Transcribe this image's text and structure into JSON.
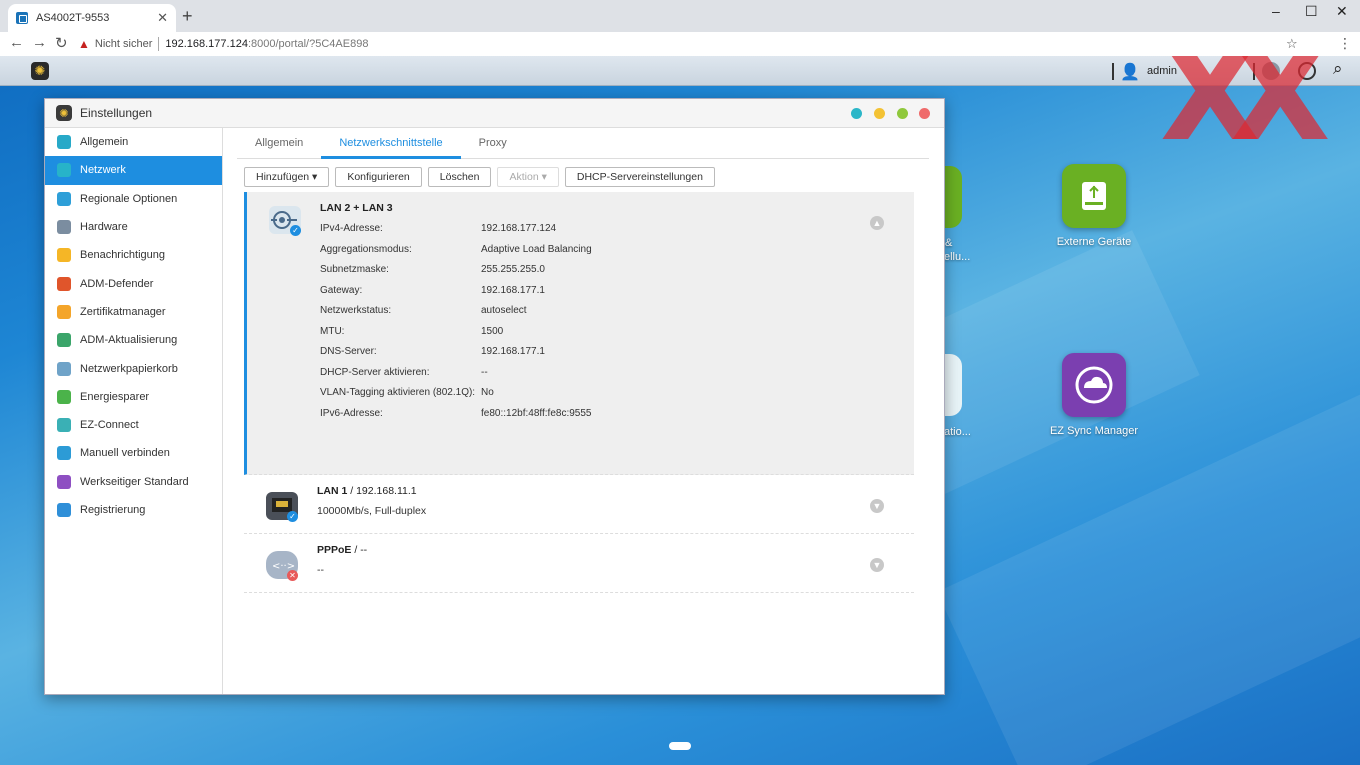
{
  "browser": {
    "tab_title": "AS4002T-9553",
    "tab_close": "✕",
    "new_tab": "+",
    "security_label": "Nicht sicher",
    "url_host": "192.168.177.124",
    "url_path": ":8000/portal/?5C4AE898",
    "win_min": "–",
    "win_max": "☐",
    "win_close": "✕"
  },
  "topbar": {
    "user_name": "admin"
  },
  "desktop_apps": [
    {
      "label": "Externe Geräte",
      "color": "#6ab023"
    },
    {
      "label": "EZ Sync Manager",
      "color": "#7b3fb0"
    }
  ],
  "desktop_partial_labels": [
    "&",
    "ellu...",
    "atio..."
  ],
  "watermark": "XX",
  "window": {
    "title": "Einstellungen",
    "dot_colors": [
      "#2bb6c8",
      "#f3c234",
      "#8fc83c",
      "#ef6a6a"
    ]
  },
  "sidebar": {
    "items": [
      {
        "label": "Allgemein",
        "color": "#27a9c8",
        "active": false
      },
      {
        "label": "Netzwerk",
        "color": "#27b3c9",
        "active": true
      },
      {
        "label": "Regionale Optionen",
        "color": "#2e9fd8",
        "active": false
      },
      {
        "label": "Hardware",
        "color": "#7b8da0",
        "active": false
      },
      {
        "label": "Benachrichtigung",
        "color": "#f5b626",
        "active": false
      },
      {
        "label": "ADM-Defender",
        "color": "#e0552b",
        "active": false
      },
      {
        "label": "Zertifikatmanager",
        "color": "#f4a52a",
        "active": false
      },
      {
        "label": "ADM-Aktualisierung",
        "color": "#3ba56a",
        "active": false
      },
      {
        "label": "Netzwerkpapierkorb",
        "color": "#6fa3c8",
        "active": false
      },
      {
        "label": "Energiesparer",
        "color": "#4bb34a",
        "active": false
      },
      {
        "label": "EZ-Connect",
        "color": "#3ab0b5",
        "active": false
      },
      {
        "label": "Manuell verbinden",
        "color": "#2c9bd6",
        "active": false
      },
      {
        "label": "Werkseitiger Standard",
        "color": "#8e4fc2",
        "active": false
      },
      {
        "label": "Registrierung",
        "color": "#2f8fd8",
        "active": false
      }
    ]
  },
  "tabs": [
    {
      "label": "Allgemein",
      "active": false
    },
    {
      "label": "Netzwerkschnittstelle",
      "active": true
    },
    {
      "label": "Proxy",
      "active": false
    }
  ],
  "toolbar": {
    "add": "Hinzufügen ▾",
    "configure": "Konfigurieren",
    "delete": "Löschen",
    "action": "Aktion ▾",
    "dhcp": "DHCP-Servereinstellungen"
  },
  "interfaces": {
    "lan23": {
      "name": "LAN 2 + LAN 3",
      "fields": [
        {
          "key": "IPv4-Adresse:",
          "value": "192.168.177.124"
        },
        {
          "key": "Aggregationsmodus:",
          "value": "Adaptive Load Balancing"
        },
        {
          "key": "Subnetzmaske:",
          "value": "255.255.255.0"
        },
        {
          "key": "Gateway:",
          "value": "192.168.177.1"
        },
        {
          "key": "Netzwerkstatus:",
          "value": "autoselect"
        },
        {
          "key": "MTU:",
          "value": "1500"
        },
        {
          "key": "DNS-Server:",
          "value": "192.168.177.1"
        },
        {
          "key": "DHCP-Server aktivieren:",
          "value": "--"
        },
        {
          "key": "VLAN-Tagging aktivieren (802.1Q):",
          "value": "No"
        },
        {
          "key": "IPv6-Adresse:",
          "value": "fe80::12bf:48ff:fe8c:9555"
        }
      ]
    },
    "lan1": {
      "name": "LAN 1",
      "sub": " / 192.168.11.1",
      "detail": "10000Mb/s, Full-duplex"
    },
    "pppoe": {
      "name": "PPPoE",
      "sub": " / --",
      "detail": "--"
    }
  }
}
